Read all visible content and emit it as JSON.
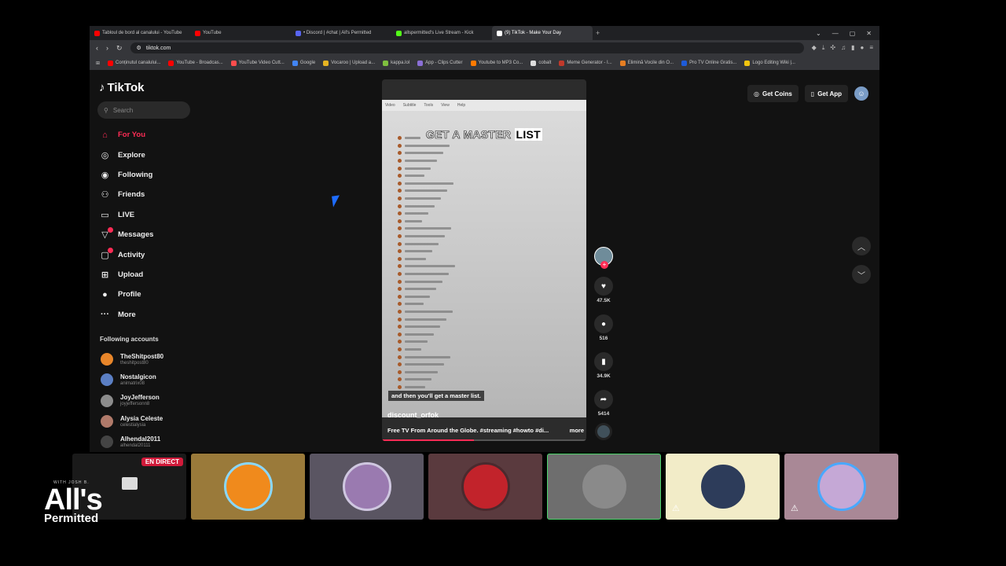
{
  "browser": {
    "tabs": [
      {
        "label": "Tabloul de bord al canalului - YouTube",
        "color": "#ff0000",
        "active": false
      },
      {
        "label": "YouTube",
        "color": "#ff0000",
        "active": false
      },
      {
        "label": "• Discord | #chat | All's Permitted",
        "color": "#5865f2",
        "active": false
      },
      {
        "label": "allspermitted's Live Stream - Kick",
        "color": "#53fc18",
        "active": false
      },
      {
        "label": "(9) TikTok - Make Your Day",
        "color": "#ffffff",
        "active": true
      }
    ],
    "new_tab": "+",
    "url": "tiktok.com",
    "bookmarks": [
      {
        "label": "Conținutul canalului...",
        "color": "#ff0000"
      },
      {
        "label": "YouTube - Broadcas...",
        "color": "#ff0000"
      },
      {
        "label": "YouTube Video Cutt...",
        "color": "#ff4d4d"
      },
      {
        "label": "Google",
        "color": "#4285f4"
      },
      {
        "label": "Vocaroo | Upload a...",
        "color": "#e6b422"
      },
      {
        "label": "kappa.lol",
        "color": "#7fbf3f"
      },
      {
        "label": "App - Clips Cutter",
        "color": "#8b6fd6"
      },
      {
        "label": "Youtube to MP3 Co...",
        "color": "#ff7a00"
      },
      {
        "label": "cobalt",
        "color": "#dddddd"
      },
      {
        "label": "Meme Generator - I...",
        "color": "#c0392b"
      },
      {
        "label": "Elimină Vocile din O...",
        "color": "#e67e22"
      },
      {
        "label": "Pro TV Online Gratis...",
        "color": "#1e5bd8"
      },
      {
        "label": "Logo Editing Wiki |...",
        "color": "#f1c40f"
      }
    ]
  },
  "tiktok": {
    "logo": "TikTok",
    "search_placeholder": "Search",
    "nav": [
      {
        "label": "For You",
        "icon": "home-icon",
        "glyph": "⌂",
        "active": true,
        "badge": false
      },
      {
        "label": "Explore",
        "icon": "compass-icon",
        "glyph": "◎",
        "active": false,
        "badge": false
      },
      {
        "label": "Following",
        "icon": "following-icon",
        "glyph": "◉",
        "active": false,
        "badge": false
      },
      {
        "label": "Friends",
        "icon": "friends-icon",
        "glyph": "⚇",
        "active": false,
        "badge": false
      },
      {
        "label": "LIVE",
        "icon": "live-icon",
        "glyph": "▭",
        "active": false,
        "badge": false
      },
      {
        "label": "Messages",
        "icon": "messages-icon",
        "glyph": "▽",
        "active": false,
        "badge": true
      },
      {
        "label": "Activity",
        "icon": "activity-icon",
        "glyph": "▢",
        "active": false,
        "badge": true
      },
      {
        "label": "Upload",
        "icon": "upload-icon",
        "glyph": "⊞",
        "active": false,
        "badge": false
      },
      {
        "label": "Profile",
        "icon": "profile-icon",
        "glyph": "●",
        "active": false,
        "badge": false
      },
      {
        "label": "More",
        "icon": "more-icon",
        "glyph": "···",
        "active": false,
        "badge": false
      }
    ],
    "following_accounts_title": "Following accounts",
    "accounts": [
      {
        "name": "TheShitpost80",
        "handle": "theshitpost80",
        "color": "#e8862a"
      },
      {
        "name": "Nostalgicon",
        "handle": "animatrix08",
        "color": "#5b7fc4"
      },
      {
        "name": "JoyJefferson",
        "handle": "joyjeffersonn8",
        "color": "#8c8c8c"
      },
      {
        "name": "Alysia Celeste",
        "handle": "celestialysia",
        "color": "#b07a6a"
      },
      {
        "name": "Alhendal2011",
        "handle": "alhendal20111",
        "color": "#444444"
      }
    ],
    "get_coins": "Get Coins",
    "get_app": "Get App",
    "video": {
      "caption_part1": "GET A MASTER ",
      "caption_part2": "LIST",
      "subtitle": "and then you'll get a master list.",
      "author": "discount_orfok",
      "description": "Free TV From Around the Globe. #streaming #howto #di...",
      "more": "more",
      "menu": [
        "Video",
        "Subtitle",
        "Tools",
        "View",
        "Help"
      ],
      "progress": 0.45
    },
    "actions": {
      "likes": "47.5K",
      "comments": "516",
      "saves": "34.9K",
      "shares": "5414"
    }
  },
  "stream": {
    "live_label": "EN DIRECT",
    "brand_small": "WITH JOSH B.",
    "brand_main": "All's",
    "brand_sub": "Permitted",
    "tiles": [
      {
        "bg": "#1a1a1a",
        "avatar": "#333333",
        "ring": "transparent",
        "muted": false
      },
      {
        "bg": "#9a7a3a",
        "avatar": "#f08a1c",
        "ring": "#8ad8ff",
        "muted": false
      },
      {
        "bg": "#5a5562",
        "avatar": "#9a7ab0",
        "ring": "#cfc7e0",
        "muted": false
      },
      {
        "bg": "#5a3a3e",
        "avatar": "#c2232b",
        "ring": "#4a2a2e",
        "muted": false
      },
      {
        "bg": "#6e6e6e",
        "avatar": "#8a8a8a",
        "ring": "#6e6e6e",
        "muted": false
      },
      {
        "bg": "#f2ecc8",
        "avatar": "#2d3c5a",
        "ring": "#f2ecc8",
        "muted": true
      },
      {
        "bg": "#a98896",
        "avatar": "#c5a8d6",
        "ring": "#49a8ff",
        "muted": true
      }
    ]
  }
}
